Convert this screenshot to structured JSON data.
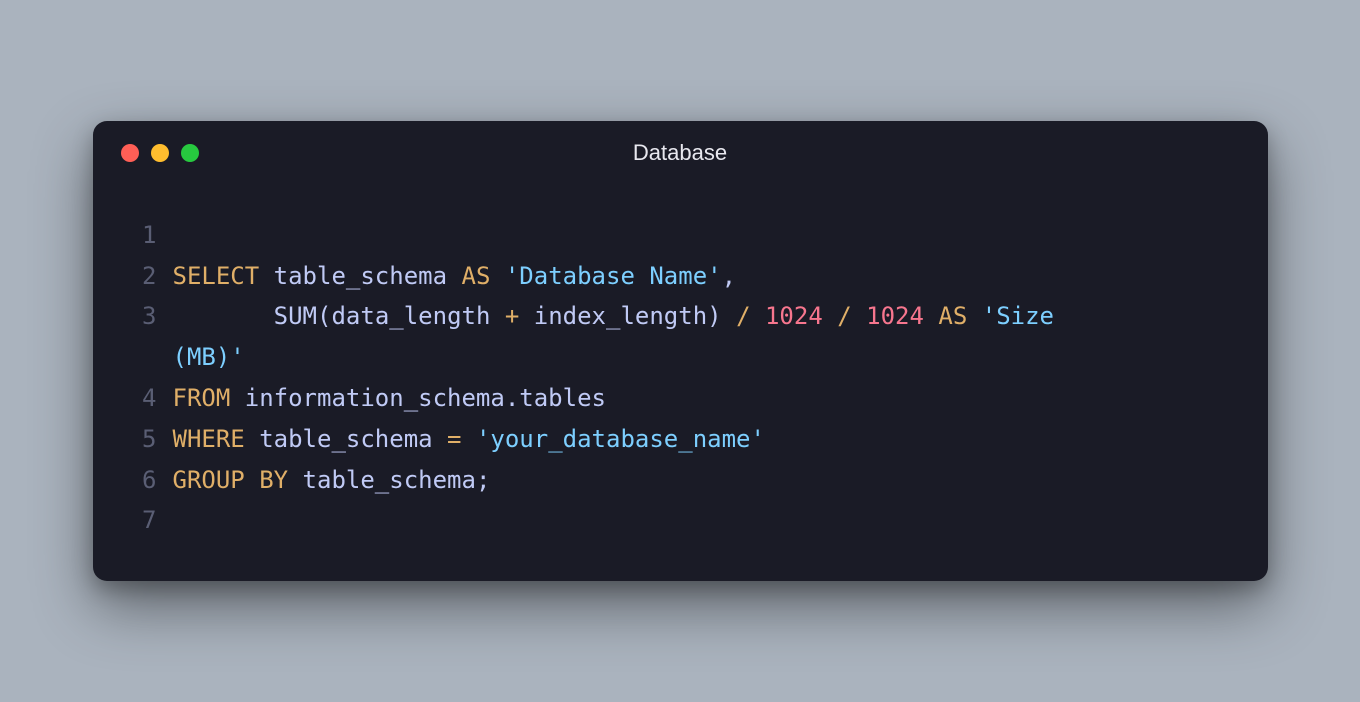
{
  "window": {
    "title": "Database"
  },
  "editor": {
    "line_numbers": [
      "1",
      "2",
      "3",
      "4",
      "5",
      "6",
      "7"
    ],
    "lines": {
      "l1_blank": "",
      "l2": {
        "kw_select": "SELECT",
        "ident1": " table_schema ",
        "kw_as": "AS",
        "str1": " 'Database Name'",
        "comma": ","
      },
      "l3": {
        "indent": "       ",
        "func": "SUM",
        "open": "(",
        "arg1": "data_length ",
        "op_plus": "+",
        "arg2": " index_length",
        "close": ")",
        "sp1": " ",
        "op_div1": "/",
        "sp2": " ",
        "num1": "1024",
        "sp3": " ",
        "op_div2": "/",
        "sp4": " ",
        "num2": "1024",
        "sp5": " ",
        "kw_as": "AS",
        "sp6": " ",
        "str_quote_open": "'",
        "str_size": "Size",
        "str_wrap": "(MB)",
        "str_quote_close": "'"
      },
      "l4": {
        "kw_from": "FROM",
        "ident": " information_schema.tables"
      },
      "l5": {
        "kw_where": "WHERE",
        "ident": " table_schema ",
        "op_eq": "=",
        "sp": " ",
        "str": "'your_database_name'"
      },
      "l6": {
        "kw_group": "GROUP",
        "sp": " ",
        "kw_by": "BY",
        "ident": " table_schema",
        "semi": ";"
      },
      "l7_blank": ""
    }
  }
}
